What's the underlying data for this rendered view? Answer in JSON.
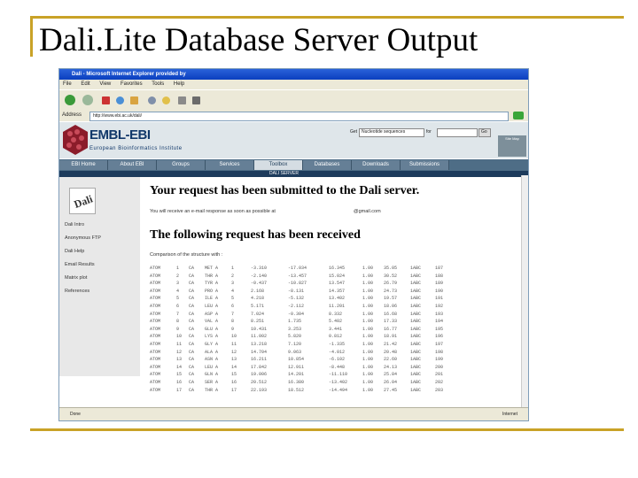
{
  "slide": {
    "title": "Dali.Lite Database Server Output"
  },
  "browser": {
    "title": "Dali - Microsoft Internet Explorer provided by",
    "menu": [
      "File",
      "Edit",
      "View",
      "Favorites",
      "Tools",
      "Help"
    ],
    "address_label": "Address",
    "address_value": "http://www.ebi.ac.uk/dali/",
    "status": "Done",
    "status_zone": "Internet"
  },
  "site": {
    "logo_text": "EMBL-EBI",
    "logo_sub": "European Bioinformatics Institute",
    "search_label": "Get",
    "search_select": "Nucleotide sequences",
    "search_for": "for",
    "search_go": "Go",
    "site_map": "Site Map",
    "tabs": [
      "EBI Home",
      "About EBI",
      "Groups",
      "Services",
      "Toolbox",
      "Databases",
      "Downloads",
      "Submissions"
    ],
    "active_tab": 4,
    "subnav": "DALI SERVER"
  },
  "leftnav": {
    "items": [
      "Dali Intro",
      "Anonymous FTP",
      "Dali Help",
      "Email Results",
      "Matrix plot",
      "References"
    ]
  },
  "main": {
    "heading_submitted": "Your request has been submitted to the Dali server.",
    "note": "You will receive an e-mail response as soon as possible at",
    "email": "@gmail.com",
    "heading_received": "The following request has been received",
    "command_line": "Comparison of the structure with :"
  },
  "atoms": [
    [
      "ATOM",
      "1",
      "CA",
      "MET A",
      "1",
      "-3.310",
      "-17.034",
      "16.345",
      "1.00",
      "35.05",
      "1ABC",
      "187"
    ],
    [
      "ATOM",
      "2",
      "CA",
      "THR A",
      "2",
      "-2.140",
      "-13.457",
      "15.024",
      "1.00",
      "30.52",
      "1ABC",
      "188"
    ],
    [
      "ATOM",
      "3",
      "CA",
      "TYR A",
      "3",
      "-0.437",
      "-10.827",
      "13.547",
      "1.00",
      "26.79",
      "1ABC",
      "189"
    ],
    [
      "ATOM",
      "4",
      "CA",
      "PRO A",
      "4",
      "2.168",
      "-8.131",
      "14.357",
      "1.00",
      "24.73",
      "1ABC",
      "190"
    ],
    [
      "ATOM",
      "5",
      "CA",
      "ILE A",
      "5",
      "4.218",
      "-5.132",
      "13.402",
      "1.00",
      "19.57",
      "1ABC",
      "191"
    ],
    [
      "ATOM",
      "6",
      "CA",
      "LEU A",
      "6",
      "5.171",
      "-2.112",
      "11.201",
      "1.00",
      "18.06",
      "1ABC",
      "192"
    ],
    [
      "ATOM",
      "7",
      "CA",
      "ASP A",
      "7",
      "7.024",
      "-0.304",
      "8.332",
      "1.00",
      "16.68",
      "1ABC",
      "193"
    ],
    [
      "ATOM",
      "8",
      "CA",
      "VAL A",
      "8",
      "8.251",
      "1.735",
      "5.402",
      "1.00",
      "17.33",
      "1ABC",
      "194"
    ],
    [
      "ATOM",
      "9",
      "CA",
      "GLU A",
      "9",
      "10.431",
      "3.253",
      "3.441",
      "1.00",
      "16.77",
      "1ABC",
      "195"
    ],
    [
      "ATOM",
      "10",
      "CA",
      "LYS A",
      "10",
      "11.002",
      "5.820",
      "0.812",
      "1.00",
      "18.91",
      "1ABC",
      "196"
    ],
    [
      "ATOM",
      "11",
      "CA",
      "GLY A",
      "11",
      "13.218",
      "7.120",
      "-1.335",
      "1.00",
      "21.42",
      "1ABC",
      "197"
    ],
    [
      "ATOM",
      "12",
      "CA",
      "ALA A",
      "12",
      "14.704",
      "9.063",
      "-4.012",
      "1.00",
      "20.48",
      "1ABC",
      "198"
    ],
    [
      "ATOM",
      "13",
      "CA",
      "ASN A",
      "13",
      "16.211",
      "10.854",
      "-6.102",
      "1.00",
      "22.60",
      "1ABC",
      "199"
    ],
    [
      "ATOM",
      "14",
      "CA",
      "LEU A",
      "14",
      "17.842",
      "12.911",
      "-8.448",
      "1.00",
      "24.13",
      "1ABC",
      "200"
    ],
    [
      "ATOM",
      "15",
      "CA",
      "GLN A",
      "15",
      "19.006",
      "14.201",
      "-11.110",
      "1.00",
      "25.84",
      "1ABC",
      "201"
    ],
    [
      "ATOM",
      "16",
      "CA",
      "SER A",
      "16",
      "20.512",
      "16.380",
      "-13.402",
      "1.00",
      "26.04",
      "1ABC",
      "202"
    ],
    [
      "ATOM",
      "17",
      "CA",
      "THR A",
      "17",
      "22.193",
      "18.512",
      "-14.494",
      "1.00",
      "27.45",
      "1ABC",
      "203"
    ]
  ]
}
